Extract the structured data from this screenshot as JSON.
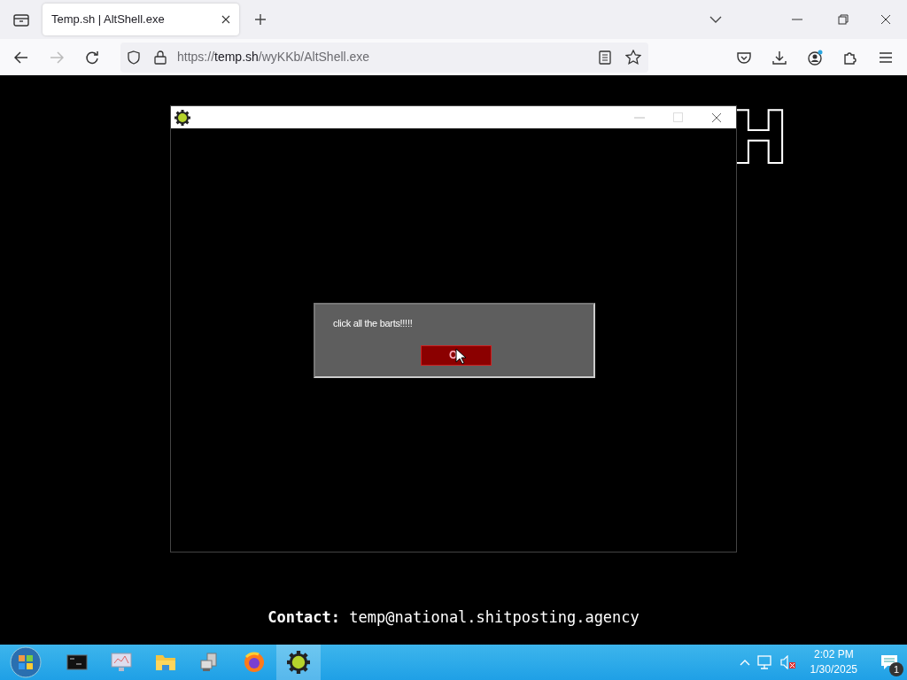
{
  "browser": {
    "tabs": [
      {
        "title": "Temp.sh | AltShell.exe",
        "selected": true
      }
    ],
    "url": {
      "scheme": "https://",
      "host": "temp.sh",
      "path": "/wyKKb/AltShell.exe"
    }
  },
  "page": {
    "banner_fragment": "H",
    "app_window": {
      "dialog": {
        "message": "click all the barts!!!!!",
        "button": "O"
      }
    },
    "contact": "**Contact:** temp@national.shitposting.agency"
  },
  "taskbar": {
    "apps": [
      {
        "kind": "terminal",
        "selected": false
      },
      {
        "kind": "monitor",
        "selected": false
      },
      {
        "kind": "folder",
        "selected": false
      },
      {
        "kind": "computer",
        "selected": false
      },
      {
        "kind": "browser",
        "selected": false
      },
      {
        "kind": "gear",
        "selected": true
      }
    ],
    "time": "2:02 PM",
    "date": "1/30/2025",
    "notifications": "1"
  }
}
